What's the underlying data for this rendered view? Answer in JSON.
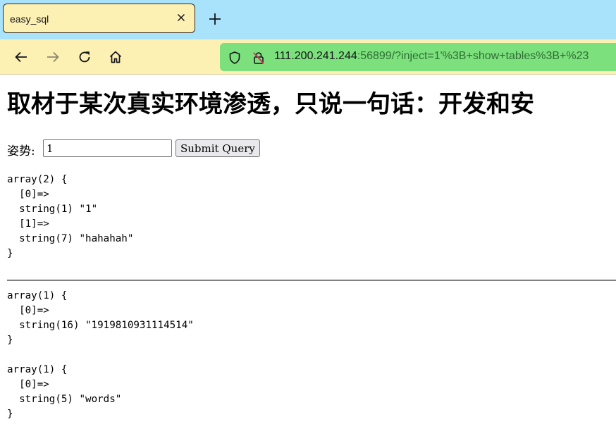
{
  "tab": {
    "title": "easy_sql"
  },
  "address": {
    "host": "111.200.241.244",
    "rest": ":56899/?inject=1'%3B+show+tables%3B+%23"
  },
  "icons": {
    "tab_close": "close-icon",
    "new_tab": "plus-icon",
    "back": "arrow-left-icon",
    "forward": "arrow-right-icon",
    "reload": "reload-icon",
    "home": "home-icon",
    "tracking": "shield-icon",
    "insecure": "insecure-lock-icon"
  },
  "colors": {
    "tabbar_bg": "#a9e3fb",
    "toolbar_bg": "#fdf0b3",
    "urlbar_bg": "#7ce07c"
  },
  "page": {
    "heading": "取材于某次真实环境渗透，只说一句话：开发和安",
    "form": {
      "label": "姿势:",
      "input_value": "1",
      "submit_label": "Submit Query"
    },
    "dumps": [
      "array(2) {\n  [0]=>\n  string(1) \"1\"\n  [1]=>\n  string(7) \"hahahah\"\n}",
      "array(1) {\n  [0]=>\n  string(16) \"1919810931114514\"\n}",
      "array(1) {\n  [0]=>\n  string(5) \"words\"\n}"
    ]
  }
}
